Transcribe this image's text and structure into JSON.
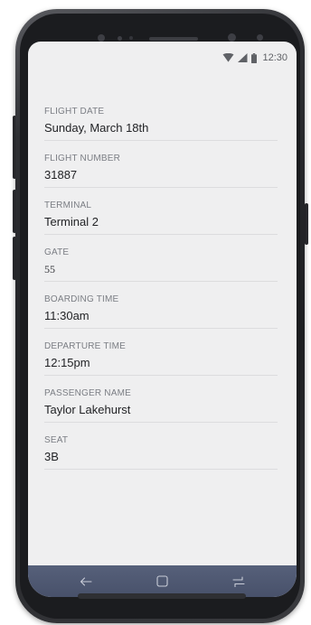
{
  "status_bar": {
    "time": "12:30",
    "wifi_icon": "wifi-icon",
    "signal_icon": "cell-signal-icon",
    "battery_icon": "battery-icon"
  },
  "fields": [
    {
      "label": "FLIGHT DATE",
      "value": "Sunday, March 18th"
    },
    {
      "label": "FLIGHT NUMBER",
      "value": "31887"
    },
    {
      "label": "TERMINAL",
      "value": "Terminal 2"
    },
    {
      "label": "GATE",
      "value": "55"
    },
    {
      "label": "BOARDING TIME",
      "value": "11:30am"
    },
    {
      "label": "DEPARTURE TIME",
      "value": "12:15pm"
    },
    {
      "label": "PASSENGER NAME",
      "value": "Taylor Lakehurst"
    },
    {
      "label": "SEAT",
      "value": "3B"
    }
  ],
  "nav_bar": {
    "back_icon": "back-arrow-icon",
    "home_icon": "home-square-icon",
    "recents_icon": "recents-icon"
  },
  "colors": {
    "screen_bg": "#efeff0",
    "label": "#7b7e84",
    "value": "#222326",
    "nav_bar": "#4e5770",
    "phone_body": "#1e1f22"
  }
}
